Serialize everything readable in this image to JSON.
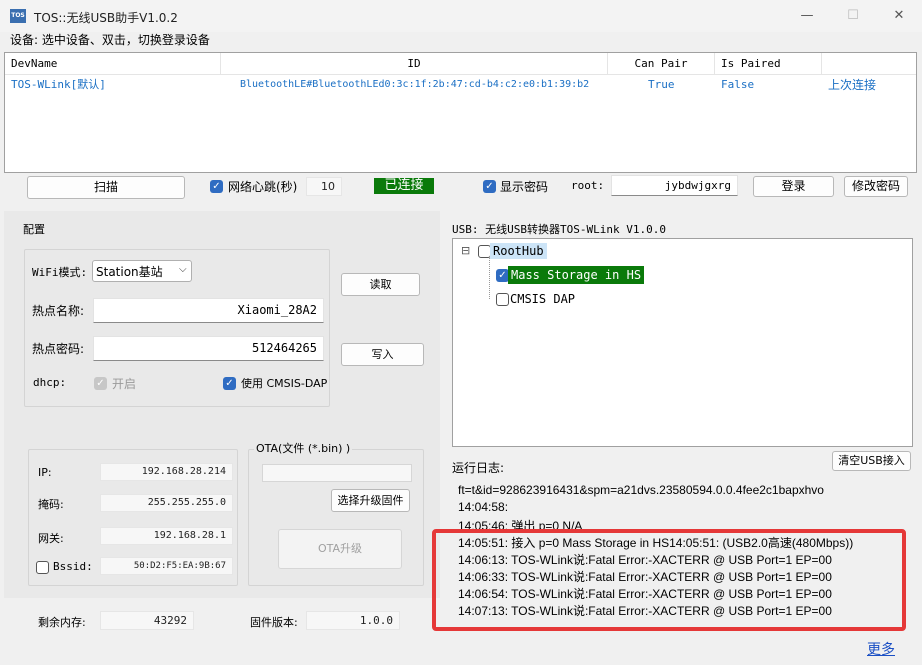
{
  "window": {
    "icon_text": "TOS",
    "title": "TOS::无线USB助手V1.0.2",
    "minimize": "—",
    "maximize": "☐",
    "close": "✕"
  },
  "hint": "设备:   选中设备、双击，切换登录设备",
  "device_table": {
    "columns": [
      "DevName",
      "ID",
      "Can Pair",
      "Is Paired",
      ""
    ],
    "rows": [
      [
        "TOS-WLink[默认]",
        "BluetoothLE#BluetoothLEd0:3c:1f:2b:47:cd-b4:c2:e0:b1:39:b2",
        "True",
        "False",
        "上次连接"
      ]
    ]
  },
  "controls": {
    "scan_button": "扫描",
    "heartbeat_label": "网络心跳(秒)",
    "heartbeat_value": "10",
    "status_badge": "已连接",
    "show_password_label": "显示密码",
    "user_label": "root:",
    "password_value": "jybdwjgxrg",
    "login_button": "登录",
    "change_password_button": "修改密码"
  },
  "config": {
    "group_title": "配置",
    "wifi_mode_label": "WiFi模式:",
    "wifi_mode_value": "Station基站",
    "ssid_label": "热点名称:",
    "ssid_value": "Xiaomi_28A2",
    "wifi_password_label": "热点密码:",
    "wifi_password_value": "512464265",
    "dhcp_label": "dhcp:",
    "dhcp_option": "开启",
    "cmsis_option": "使用 CMSIS-DAP",
    "read_button": "读取",
    "write_button": "写入"
  },
  "network": {
    "ip_label": "IP:",
    "ip_value": "192.168.28.214",
    "mask_label": "掩码:",
    "mask_value": "255.255.255.0",
    "gateway_label": "网关:",
    "gateway_value": "192.168.28.1",
    "bssid_label": "Bssid:",
    "bssid_value": "50:D2:F5:EA:9B:67"
  },
  "ota": {
    "group_title": "OTA(文件 (*.bin) )",
    "select_button": "选择升级固件",
    "upgrade_button": "OTA升级"
  },
  "footer": {
    "free_mem_label": "剩余内存:",
    "free_mem_value": "43292",
    "fw_version_label": "固件版本:",
    "fw_version_value": "1.0.0",
    "more_link": "更多"
  },
  "usb": {
    "title": "USB: 无线USB转换器TOS-WLink V1.0.0",
    "tree": {
      "expander": "⊟",
      "root": "RootHub",
      "children": [
        "Mass Storage in HS",
        "CMSIS DAP"
      ]
    }
  },
  "log": {
    "label": "运行日志:",
    "clear_button": "清空USB接入",
    "lines": [
      "ft=t&id=928623916431&spm=a21dvs.23580594.0.0.4fee2c1bapxhvo",
      "14:04:58:",
      "14:05:46: 弹出 p=0 N/A",
      "14:05:51: 接入 p=0 Mass Storage in HS14:05:51: (USB2.0高速(480Mbps))",
      "14:06:13:  TOS-WLink说:Fatal Error:-XACTERR @ USB Port=1 EP=00",
      "14:06:33:  TOS-WLink说:Fatal Error:-XACTERR @ USB Port=1 EP=00",
      "14:06:54:  TOS-WLink说:Fatal Error:-XACTERR @ USB Port=1 EP=00",
      "14:07:13:  TOS-WLink说:Fatal Error:-XACTERR @ USB Port=1 EP=00"
    ]
  },
  "colors": {
    "status_green": "#0a7a0a",
    "highlight_red": "#e53838",
    "link_blue": "#1a6fc4",
    "selection_blue": "#cce4f7"
  }
}
